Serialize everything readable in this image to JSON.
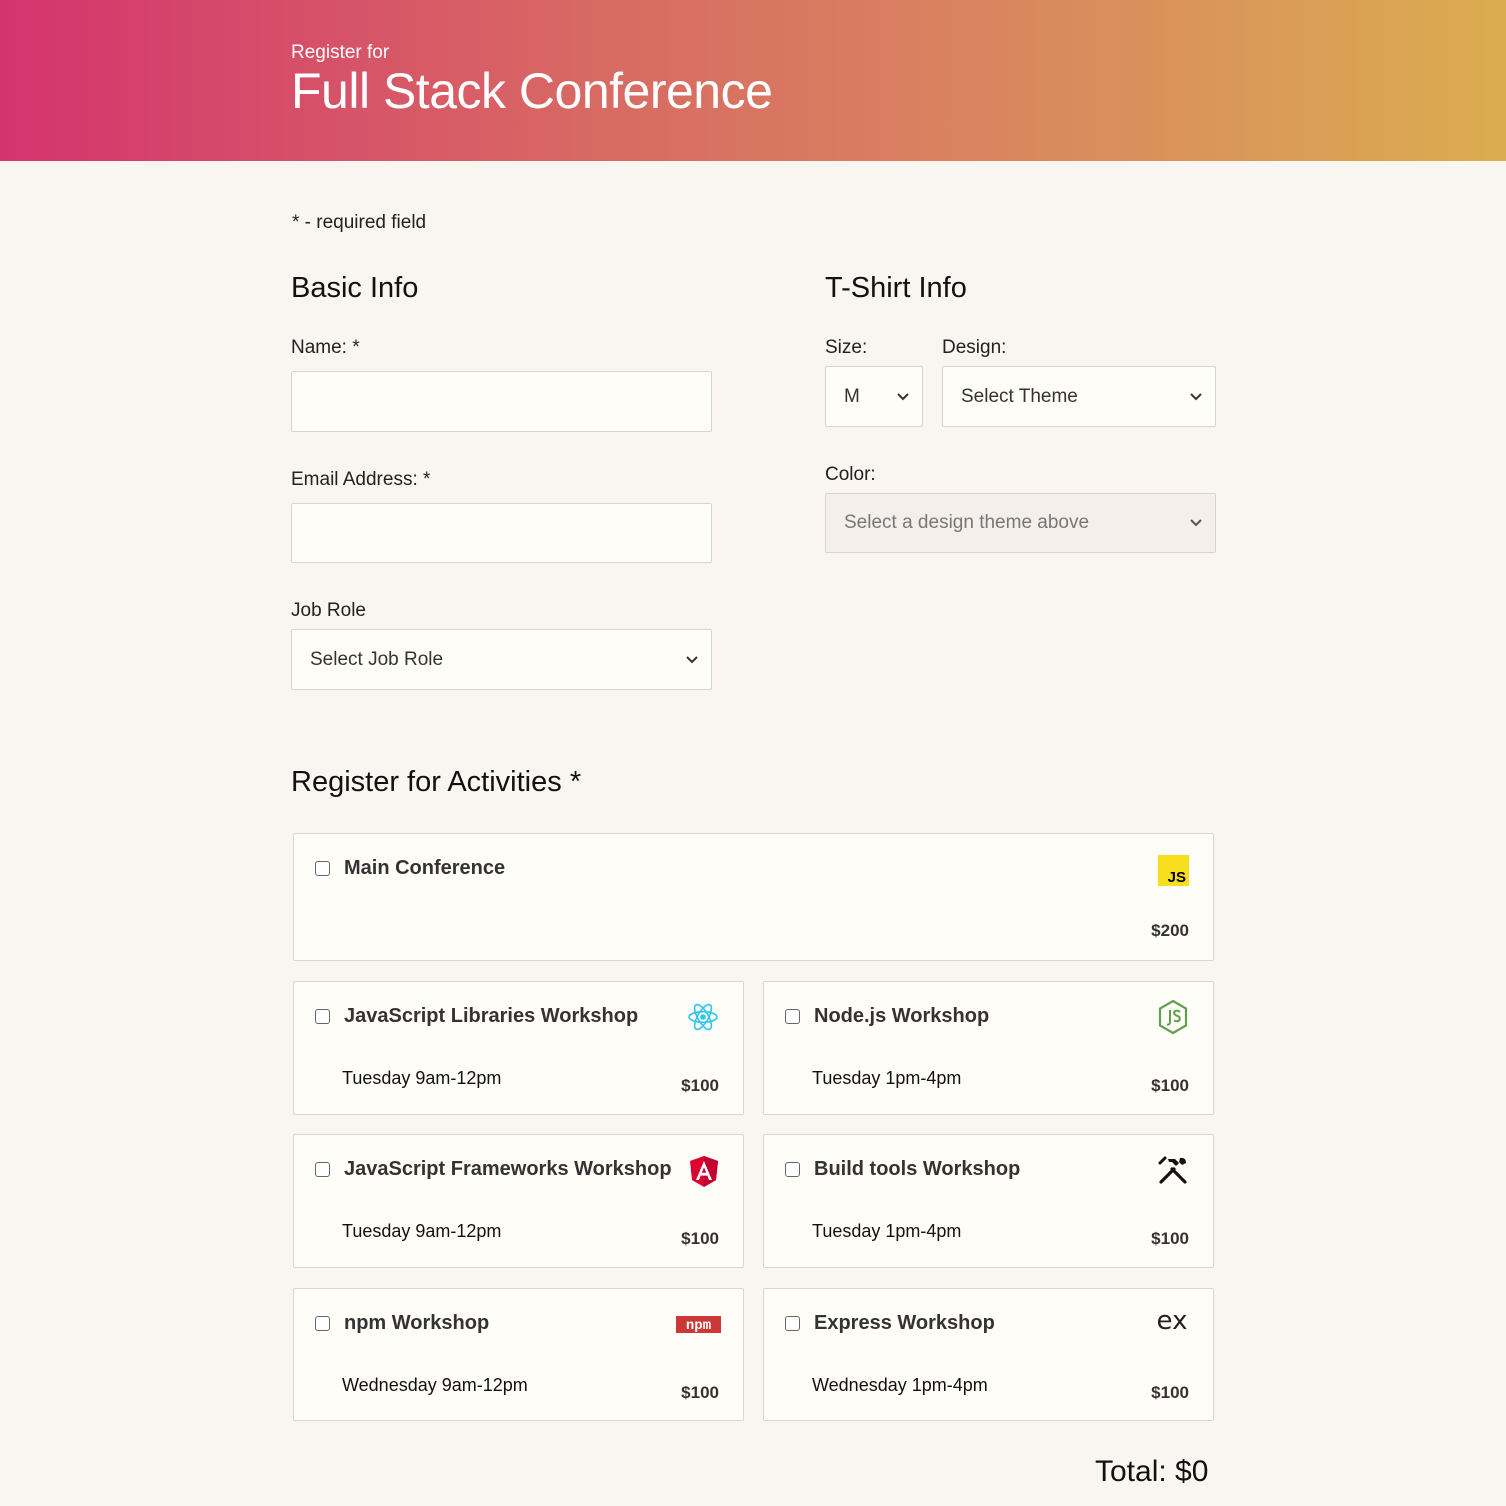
{
  "header": {
    "pretitle": "Register for",
    "title": "Full Stack Conference"
  },
  "required_note": "* - required field",
  "basic_info": {
    "heading": "Basic Info",
    "name_label": "Name: *",
    "name_value": "",
    "email_label": "Email Address: *",
    "email_value": "",
    "job_role_label": "Job Role",
    "job_role_selected": "Select Job Role"
  },
  "tshirt_info": {
    "heading": "T-Shirt Info",
    "size_label": "Size:",
    "size_selected": "M",
    "design_label": "Design:",
    "design_selected": "Select Theme",
    "color_label": "Color:",
    "color_selected": "Select a design theme above"
  },
  "activities": {
    "heading": "Register for Activities *",
    "items": [
      {
        "name": "Main Conference",
        "time": "",
        "price": "$200",
        "icon": "javascript-icon",
        "checked": false
      },
      {
        "name": "JavaScript Libraries Workshop",
        "time": "Tuesday 9am-12pm",
        "price": "$100",
        "icon": "react-icon",
        "checked": false
      },
      {
        "name": "Node.js Workshop",
        "time": "Tuesday 1pm-4pm",
        "price": "$100",
        "icon": "nodejs-icon",
        "checked": false
      },
      {
        "name": "JavaScript Frameworks Workshop",
        "time": "Tuesday 9am-12pm",
        "price": "$100",
        "icon": "angular-icon",
        "checked": false
      },
      {
        "name": "Build tools Workshop",
        "time": "Tuesday 1pm-4pm",
        "price": "$100",
        "icon": "tools-icon",
        "checked": false
      },
      {
        "name": "npm Workshop",
        "time": "Wednesday 9am-12pm",
        "price": "$100",
        "icon": "npm-icon",
        "checked": false
      },
      {
        "name": "Express Workshop",
        "time": "Wednesday 1pm-4pm",
        "price": "$100",
        "icon": "express-icon",
        "checked": false
      }
    ]
  },
  "icon_text": {
    "js": "JS",
    "npm": "npm",
    "express": "ex"
  },
  "total": "Total: $0",
  "colors": {
    "gradient_start": "#d4346e",
    "gradient_end": "#dbad50",
    "background": "#f9f5f0"
  }
}
